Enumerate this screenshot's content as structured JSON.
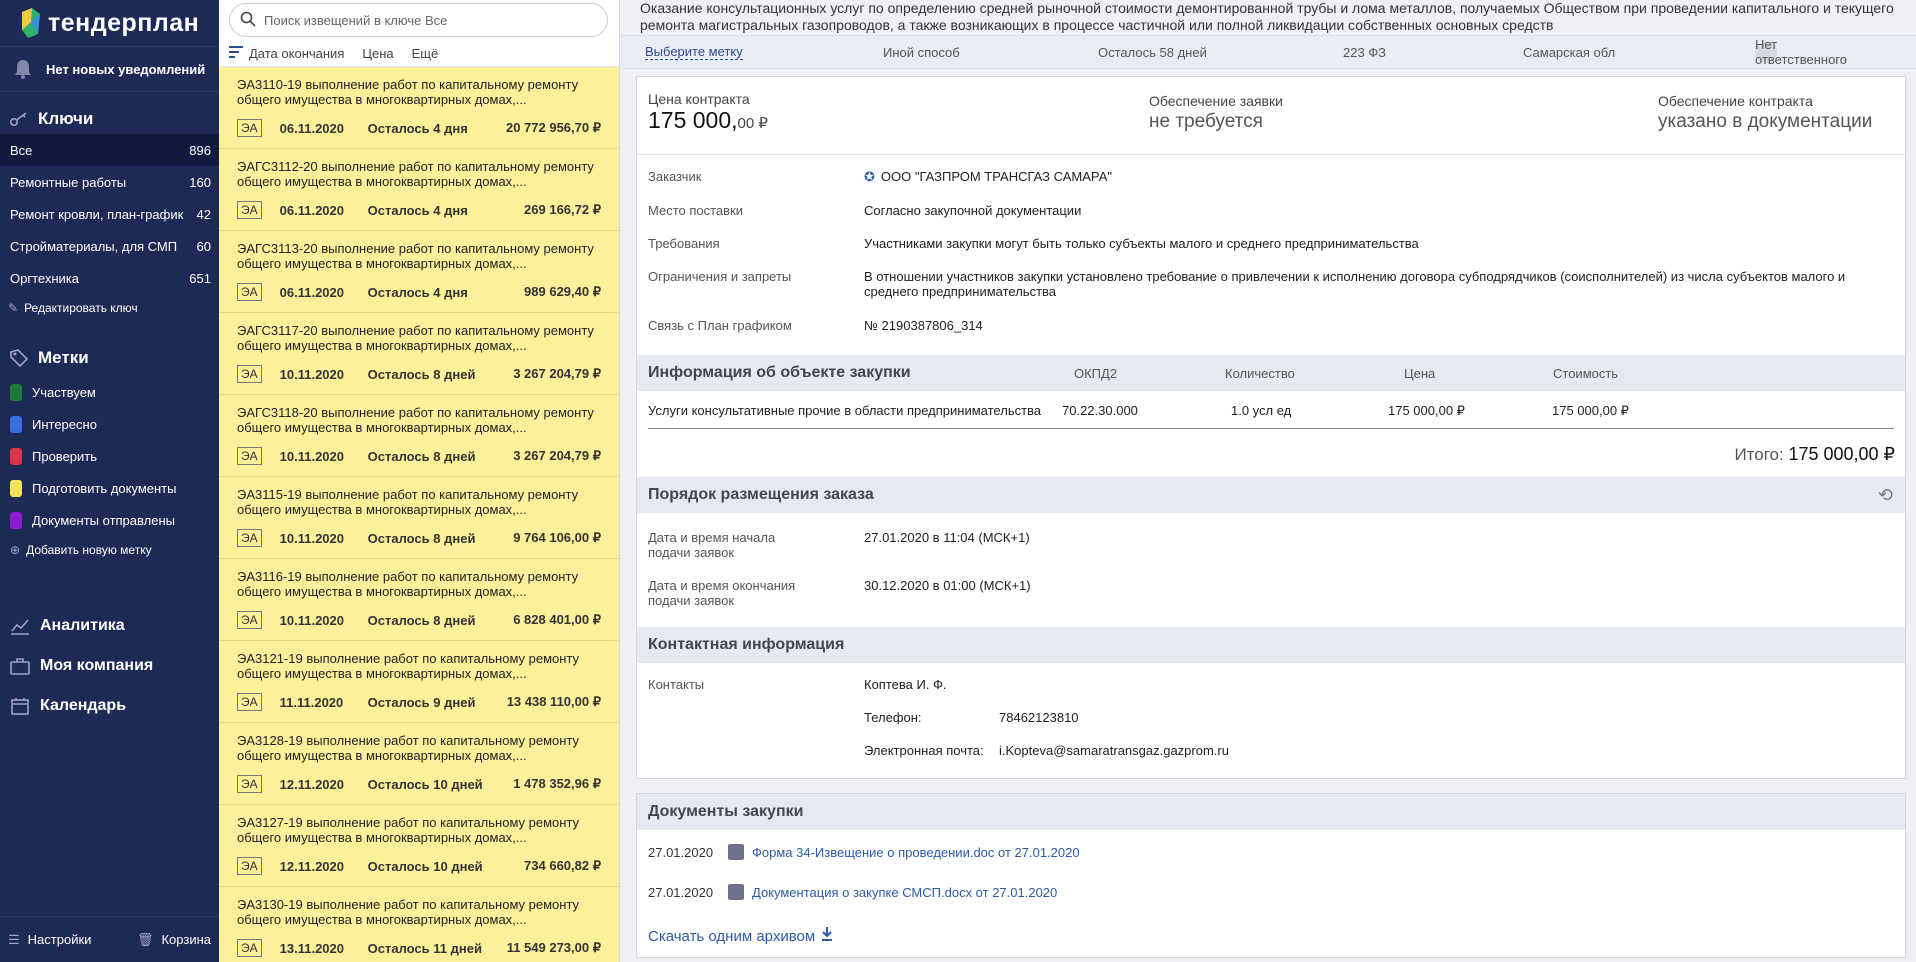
{
  "sidebar": {
    "brand": "тендерплан",
    "notifications": "Нет новых уведомлений",
    "keys_title": "Ключи",
    "keys": [
      {
        "label": "Все",
        "count": "896"
      },
      {
        "label": "Ремонтные работы",
        "count": "160"
      },
      {
        "label": "Ремонт кровли, план-график",
        "count": "42"
      },
      {
        "label": "Стройматериалы, для СМП",
        "count": "60"
      },
      {
        "label": "Оргтехника",
        "count": "651"
      }
    ],
    "edit_key": "Редактировать ключ",
    "labels_title": "Метки",
    "labels": [
      {
        "label": "Участвуем",
        "color": "#1e7a3a"
      },
      {
        "label": "Интересно",
        "color": "#3a6ee0"
      },
      {
        "label": "Проверить",
        "color": "#d9364a"
      },
      {
        "label": "Подготовить документы",
        "color": "#f4e25a"
      },
      {
        "label": "Документы отправлены",
        "color": "#8d1bd1"
      }
    ],
    "add_label": "Добавить новую метку",
    "nav": {
      "analytics": "Аналитика",
      "company": "Моя компания",
      "calendar": "Календарь"
    },
    "settings": "Настройки",
    "trash": "Корзина"
  },
  "list": {
    "search_placeholder": "Поиск извещений в ключе Все",
    "sort": {
      "end_date": "Дата окончания",
      "price": "Цена",
      "more": "Ещё"
    },
    "items": [
      {
        "title": "ЭА3110-19 выполнение работ по капитальному ремонту общего имущества в многоквартирных домах,...",
        "badge": "ЭА",
        "date": "06.11.2020",
        "left": "Осталось 4 дня",
        "price": "20 772 956,70 ₽"
      },
      {
        "title": "ЭАГС3112-20 выполнение работ по капитальному ремонту общего имущества в многоквартирных домах,...",
        "badge": "ЭА",
        "date": "06.11.2020",
        "left": "Осталось 4 дня",
        "price": "269 166,72 ₽"
      },
      {
        "title": "ЭАГС3113-20 выполнение работ по капитальному ремонту общего имущества в многоквартирных домах,...",
        "badge": "ЭА",
        "date": "06.11.2020",
        "left": "Осталось 4 дня",
        "price": "989 629,40 ₽"
      },
      {
        "title": "ЭАГС3117-20 выполнение работ по капитальному ремонту общего имущества в многоквартирных домах,...",
        "badge": "ЭА",
        "date": "10.11.2020",
        "left": "Осталось 8 дней",
        "price": "3 267 204,79 ₽"
      },
      {
        "title": "ЭАГС3118-20 выполнение работ по капитальному ремонту общего имущества в многоквартирных домах,...",
        "badge": "ЭА",
        "date": "10.11.2020",
        "left": "Осталось 8 дней",
        "price": "3 267 204,79 ₽"
      },
      {
        "title": "ЭА3115-19 выполнение работ по капитальному ремонту общего имущества в многоквартирных домах,...",
        "badge": "ЭА",
        "date": "10.11.2020",
        "left": "Осталось 8 дней",
        "price": "9 764 106,00 ₽"
      },
      {
        "title": "ЭА3116-19 выполнение работ по капитальному ремонту общего имущества в многоквартирных домах,...",
        "badge": "ЭА",
        "date": "10.11.2020",
        "left": "Осталось 8 дней",
        "price": "6 828 401,00 ₽"
      },
      {
        "title": "ЭА3121-19 выполнение работ по капитальному ремонту общего имущества в многоквартирных домах,...",
        "badge": "ЭА",
        "date": "11.11.2020",
        "left": "Осталось 9 дней",
        "price": "13 438 110,00 ₽"
      },
      {
        "title": "ЭА3128-19 выполнение работ по капитальному ремонту общего имущества в многоквартирных домах,...",
        "badge": "ЭА",
        "date": "12.11.2020",
        "left": "Осталось 10 дней",
        "price": "1 478 352,96 ₽"
      },
      {
        "title": "ЭА3127-19 выполнение работ по капитальному ремонту общего имущества в многоквартирных домах,...",
        "badge": "ЭА",
        "date": "12.11.2020",
        "left": "Осталось 10 дней",
        "price": "734 660,82 ₽"
      },
      {
        "title": "ЭА3130-19 выполнение работ по капитальному ремонту общего имущества в многоквартирных домах,...",
        "badge": "ЭА",
        "date": "13.11.2020",
        "left": "Осталось 11 дней",
        "price": "11 549 273,00 ₽"
      }
    ]
  },
  "detail": {
    "title": "Оказание консультационных услуг по определению средней рыночной стоимости демонтированной трубы и лома металлов, получаемых Обществом при проведении капитального и текущего ремонта магистральных газопроводов, а также возникающих в процессе частичной или полной ликвидации собственных основных средств",
    "topbar": {
      "choose_mark": "Выберите метку",
      "method": "Иной способ",
      "days_left": "Осталось 58 дней",
      "law": "223 ФЗ",
      "region": "Самарская обл",
      "responsible": "Нет ответственного"
    },
    "contract_price_label": "Цена контракта",
    "contract_price_main": "175 000,",
    "contract_price_cents": "00 ₽",
    "bid_security_label": "Обеспечение заявки",
    "bid_security_value": "не требуется",
    "contract_security_label": "Обеспечение контракта",
    "contract_security_value": "указано в документации",
    "customer_label": "Заказчик",
    "customer_value": "ООО \"ГАЗПРОМ ТРАНСГАЗ САМАРА\"",
    "delivery_label": "Место поставки",
    "delivery_value": "Согласно закупочной документации",
    "requirements_label": "Требования",
    "requirements_value": "Участниками закупки могут быть только субъекты малого и среднего предпринимательства",
    "restrictions_label": "Ограничения и запреты",
    "restrictions_value": "В отношении участников закупки установлено требование о привлечении к исполнению договора субподрядчиков (соисполнителей) из числа субъектов малого и среднего предпринимательства",
    "plan_label": "Связь с План графиком",
    "plan_value": "№ 2190387806_314",
    "object_section": "Информация об объекте закупки",
    "object_cols": {
      "okpd": "ОКПД2",
      "qty": "Количество",
      "price": "Цена",
      "cost": "Стоимость"
    },
    "object_item": {
      "name": "Услуги консультативные прочие в области предпринимательства",
      "okpd": "70.22.30.000",
      "qty": "1.0 усл ед",
      "price": "175 000,00 ₽",
      "cost": "175 000,00 ₽"
    },
    "total_label": "Итого:",
    "total_value": "175 000,00 ₽",
    "order_section": "Порядок размещения заказа",
    "start_label": "Дата и время начала подачи заявок",
    "start_value": "27.01.2020 в 11:04 (МСК+1)",
    "end_label": "Дата и время окончания подачи заявок",
    "end_value": "30.12.2020 в 01:00 (МСК+1)",
    "contact_section": "Контактная информация",
    "contacts_label": "Контакты",
    "contact_name": "Коптева И. Ф.",
    "phone_label": "Телефон:",
    "phone_value": "78462123810",
    "email_label": "Электронная почта:",
    "email_value": "i.Kopteva@samaratransgaz.gazprom.ru",
    "docs_section": "Документы закупки",
    "docs": [
      {
        "date": "27.01.2020",
        "name": "Форма 34-Извещение о проведении.doc от 27.01.2020"
      },
      {
        "date": "27.01.2020",
        "name": "Документация о закупке СМСП.docx от 27.01.2020"
      }
    ],
    "archive": "Скачать одним архивом"
  }
}
